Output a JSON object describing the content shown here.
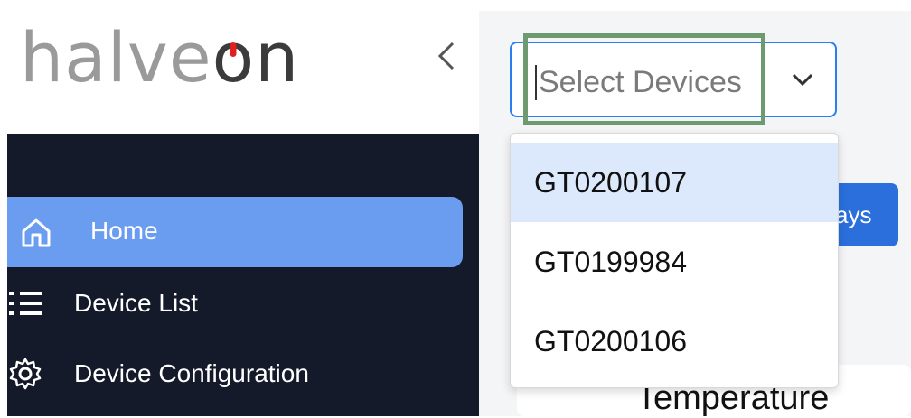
{
  "logo": {
    "part1": "halve",
    "part2": "o",
    "part3": "n"
  },
  "sidebar": {
    "collapse_glyph": "‹",
    "items": [
      {
        "label": "Home",
        "icon": "home-icon",
        "active": true
      },
      {
        "label": "Device List",
        "icon": "list-icon",
        "active": false
      },
      {
        "label": "Device Configuration",
        "icon": "gear-icon",
        "active": false
      }
    ]
  },
  "device_select": {
    "placeholder": "Select Devices",
    "options": [
      "GT0200107",
      "GT0199984",
      "GT0200106"
    ],
    "highlighted_index": 0
  },
  "days_button": {
    "label": "ays"
  },
  "card": {
    "title": "Temperature"
  },
  "colors": {
    "sidebar_bg": "#141a2a",
    "active_item": "#6a9cf0",
    "accent": "#2a6fdc",
    "logo_red": "#e02020"
  }
}
